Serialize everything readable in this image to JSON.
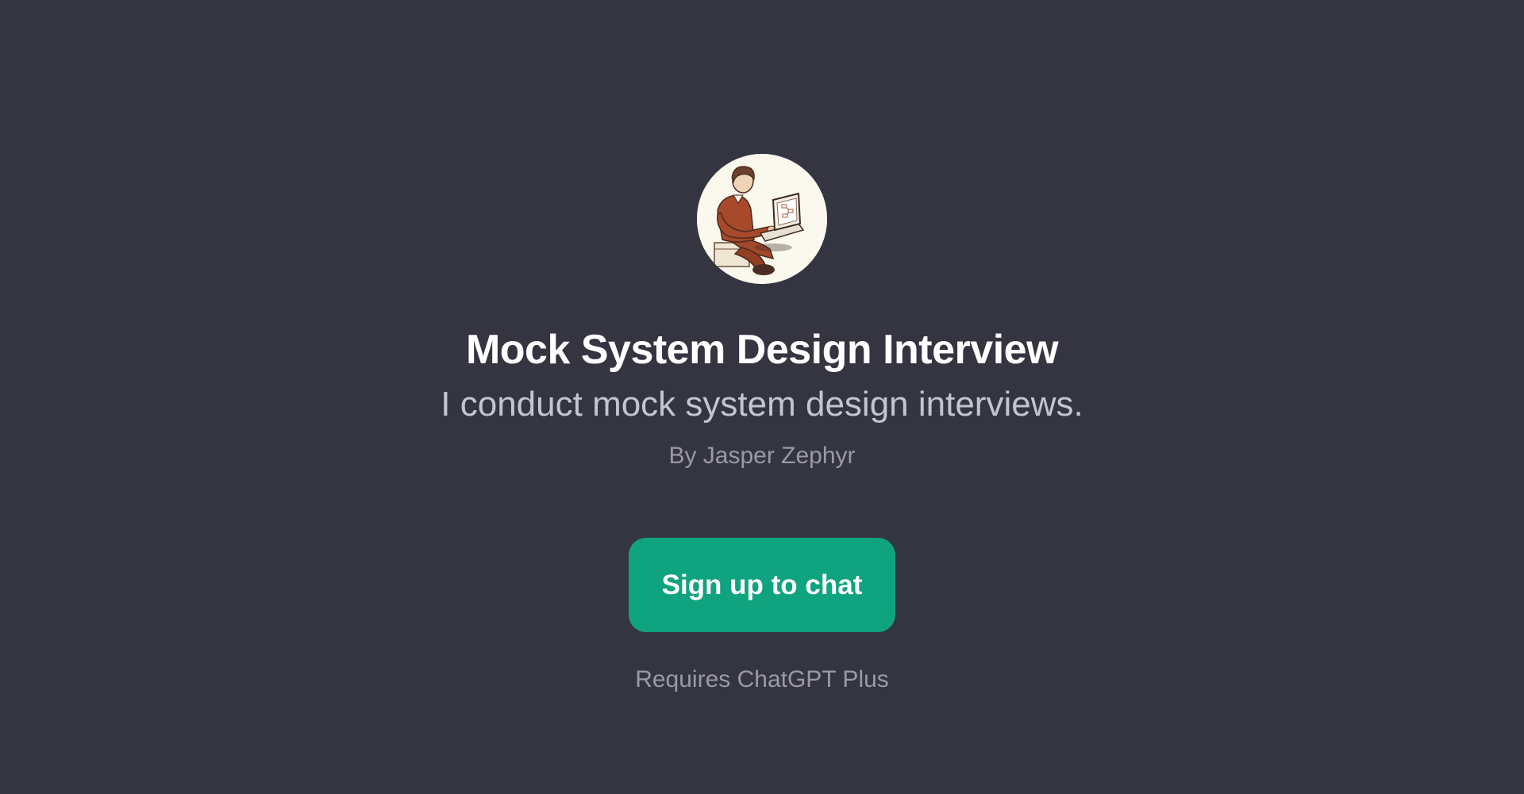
{
  "gpt": {
    "avatar_icon": "person-with-laptop-avatar",
    "title": "Mock System Design Interview",
    "description": "I conduct mock system design interviews.",
    "author": "By Jasper Zephyr"
  },
  "actions": {
    "signup_label": "Sign up to chat"
  },
  "footer": {
    "requirement": "Requires ChatGPT Plus"
  },
  "colors": {
    "background": "#343541",
    "button": "#10a37f",
    "title": "#ffffff",
    "subtitle": "#c5c5d2",
    "muted": "#9a9aa6"
  }
}
